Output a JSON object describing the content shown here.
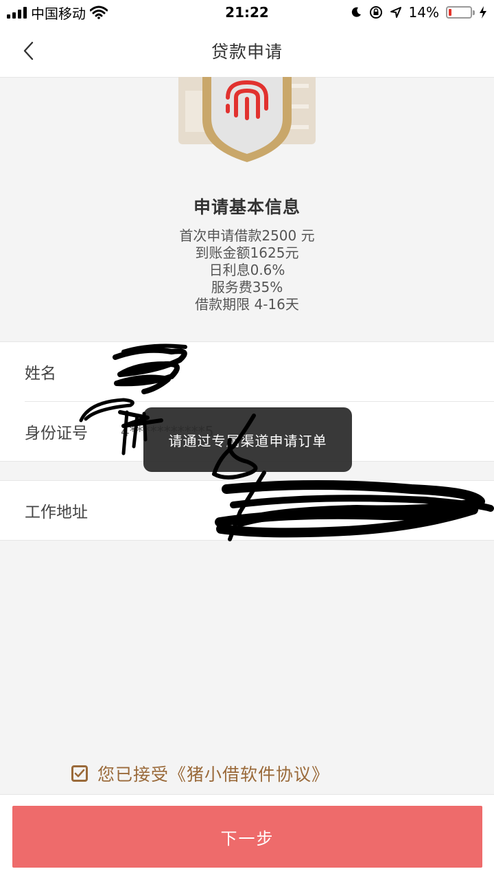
{
  "status_bar": {
    "carrier": "中国移动",
    "time": "21:22",
    "battery_percent": "14%",
    "battery_level": 0.14,
    "icons": [
      "signal-icon",
      "wifi-icon",
      "moon-icon",
      "rotation-lock-icon",
      "location-icon",
      "battery-icon",
      "charging-icon"
    ]
  },
  "navbar": {
    "title": "贷款申请",
    "back_icon": "chevron-left-icon"
  },
  "hero": {
    "icon": "fingerprint-shield-icon"
  },
  "info": {
    "title": "申请基本信息",
    "lines": [
      "首次申请借款2500 元",
      "到账金额1625元",
      "日利息0.6%",
      "服务费35%",
      "借款期限 4-16天"
    ]
  },
  "form": {
    "name_label": "姓名",
    "name_value": "",
    "id_label": "身份证号",
    "id_value": "4***********5",
    "address_label": "工作地址",
    "address_value": ""
  },
  "toast": {
    "text": "请通过专属渠道申请订单"
  },
  "agreement": {
    "checked": true,
    "text": "您已接受《猪小借软件协议》"
  },
  "actions": {
    "next_label": "下一步"
  },
  "colors": {
    "accent": "#ee6b6b",
    "agreement": "#9a6a3a",
    "badge_gold": "#c9a76a",
    "fingerprint": "#e1322f"
  }
}
